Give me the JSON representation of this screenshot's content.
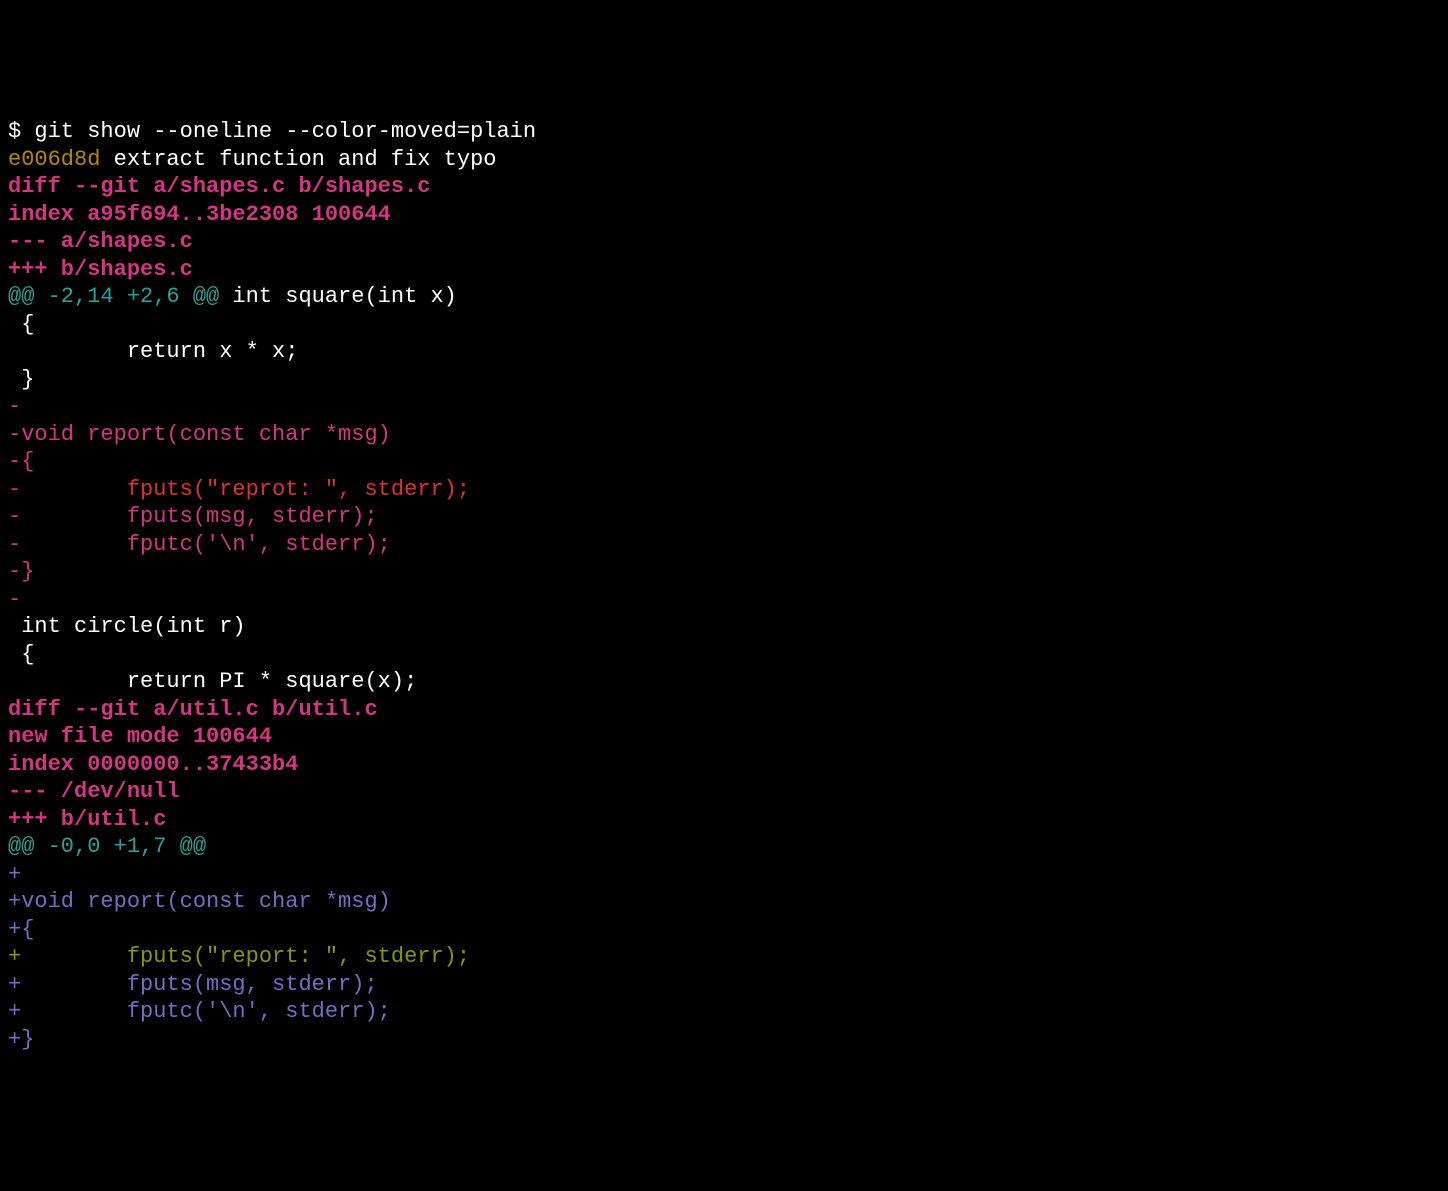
{
  "lines": [
    {
      "segments": [
        {
          "cls": "prompt",
          "text": "$ git show --oneline --color-moved=plain"
        }
      ]
    },
    {
      "segments": [
        {
          "cls": "hash",
          "text": "e006d8d"
        },
        {
          "cls": "white",
          "text": " extract function and fix typo"
        }
      ]
    },
    {
      "segments": [
        {
          "cls": "magenta-bold",
          "text": "diff --git a/shapes.c b/shapes.c"
        }
      ]
    },
    {
      "segments": [
        {
          "cls": "magenta-bold",
          "text": "index a95f694..3be2308 100644"
        }
      ]
    },
    {
      "segments": [
        {
          "cls": "magenta-bold",
          "text": "--- a/shapes.c"
        }
      ]
    },
    {
      "segments": [
        {
          "cls": "magenta-bold",
          "text": "+++ b/shapes.c"
        }
      ]
    },
    {
      "segments": [
        {
          "cls": "cyan",
          "text": "@@ -2,14 +2,6 @@"
        },
        {
          "cls": "white",
          "text": " int square(int x)"
        }
      ]
    },
    {
      "segments": [
        {
          "cls": "white",
          "text": " {"
        }
      ]
    },
    {
      "segments": [
        {
          "cls": "white",
          "text": "         return x * x;"
        }
      ]
    },
    {
      "segments": [
        {
          "cls": "white",
          "text": " }"
        }
      ]
    },
    {
      "segments": [
        {
          "cls": "moved-del",
          "text": "-"
        }
      ]
    },
    {
      "segments": [
        {
          "cls": "moved-del",
          "text": "-void report(const char *msg)"
        }
      ]
    },
    {
      "segments": [
        {
          "cls": "moved-del",
          "text": "-{"
        }
      ]
    },
    {
      "segments": [
        {
          "cls": "red",
          "text": "-        fputs(\"reprot: \", stderr);"
        }
      ]
    },
    {
      "segments": [
        {
          "cls": "moved-del",
          "text": "-        fputs(msg, stderr);"
        }
      ]
    },
    {
      "segments": [
        {
          "cls": "moved-del",
          "text": "-        fputc('\\n', stderr);"
        }
      ]
    },
    {
      "segments": [
        {
          "cls": "moved-del",
          "text": "-}"
        }
      ]
    },
    {
      "segments": [
        {
          "cls": "moved-del",
          "text": "-"
        }
      ]
    },
    {
      "segments": [
        {
          "cls": "white",
          "text": " int circle(int r)"
        }
      ]
    },
    {
      "segments": [
        {
          "cls": "white",
          "text": " {"
        }
      ]
    },
    {
      "segments": [
        {
          "cls": "white",
          "text": "         return PI * square(x);"
        }
      ]
    },
    {
      "segments": [
        {
          "cls": "magenta-bold",
          "text": "diff --git a/util.c b/util.c"
        }
      ]
    },
    {
      "segments": [
        {
          "cls": "magenta-bold",
          "text": "new file mode 100644"
        }
      ]
    },
    {
      "segments": [
        {
          "cls": "magenta-bold",
          "text": "index 0000000..37433b4"
        }
      ]
    },
    {
      "segments": [
        {
          "cls": "magenta-bold",
          "text": "--- /dev/null"
        }
      ]
    },
    {
      "segments": [
        {
          "cls": "magenta-bold",
          "text": "+++ b/util.c"
        }
      ]
    },
    {
      "segments": [
        {
          "cls": "cyan",
          "text": "@@ -0,0 +1,7 @@"
        }
      ]
    },
    {
      "segments": [
        {
          "cls": "moved-add",
          "text": "+"
        }
      ]
    },
    {
      "segments": [
        {
          "cls": "moved-add",
          "text": "+void report(const char *msg)"
        }
      ]
    },
    {
      "segments": [
        {
          "cls": "moved-add",
          "text": "+{"
        }
      ]
    },
    {
      "segments": [
        {
          "cls": "green",
          "text": "+        fputs(\"report: \", stderr);"
        }
      ]
    },
    {
      "segments": [
        {
          "cls": "moved-add",
          "text": "+        fputs(msg, stderr);"
        }
      ]
    },
    {
      "segments": [
        {
          "cls": "moved-add",
          "text": "+        fputc('\\n', stderr);"
        }
      ]
    },
    {
      "segments": [
        {
          "cls": "moved-add",
          "text": "+}"
        }
      ]
    }
  ]
}
